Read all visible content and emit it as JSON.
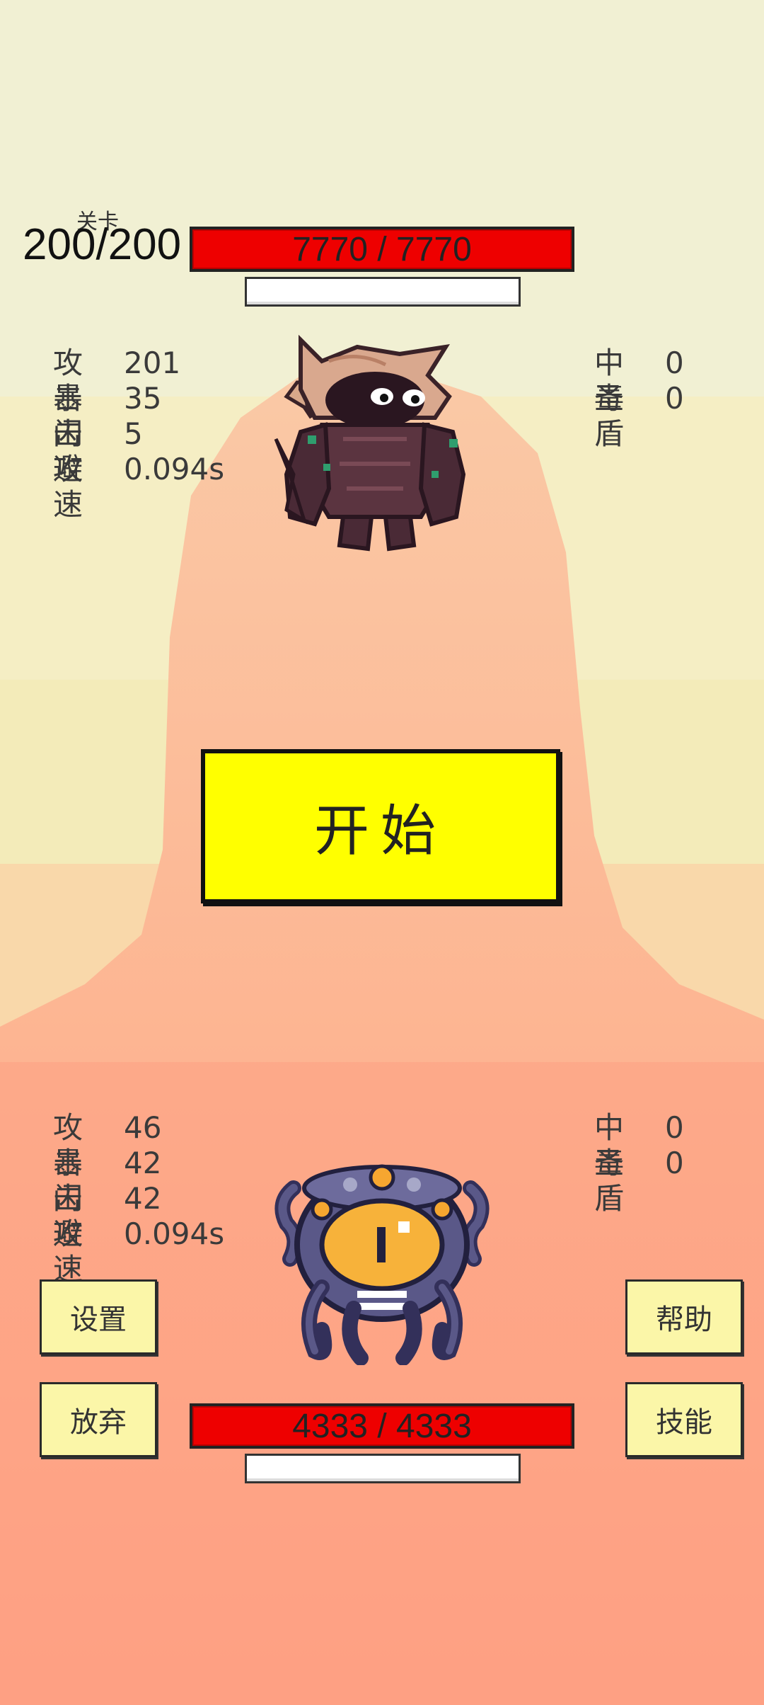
{
  "level": {
    "label": "关卡",
    "value": "200/200"
  },
  "enemy": {
    "hp_text": "7770 / 7770",
    "hp_fraction": 1.0,
    "stats_left": [
      {
        "label": "攻击",
        "value": "201"
      },
      {
        "label": "暴击",
        "value": "35"
      },
      {
        "label": "闪避",
        "value": "5"
      },
      {
        "label": "攻速",
        "value": "0.094s"
      }
    ],
    "stats_right": [
      {
        "label": "中毒",
        "value": "0"
      },
      {
        "label": "圣盾",
        "value": "0"
      }
    ],
    "sprite": "horned-golem-monster"
  },
  "player": {
    "hp_text": "4333 / 4333",
    "hp_fraction": 1.0,
    "stats_left": [
      {
        "label": "攻击",
        "value": "46"
      },
      {
        "label": "暴击",
        "value": "42"
      },
      {
        "label": "闪避",
        "value": "42"
      },
      {
        "label": "攻速",
        "value": "0.094s"
      }
    ],
    "stats_right": [
      {
        "label": "中毒",
        "value": "0"
      },
      {
        "label": "圣盾",
        "value": "0"
      }
    ],
    "sprite": "one-eyed-tentacle-monster"
  },
  "buttons": {
    "start": "开始",
    "settings": "设置",
    "help": "帮助",
    "give_up": "放弃",
    "skills": "技能"
  },
  "colors": {
    "hp_red": "#ee0000",
    "start_yellow": "#ffff00",
    "button_cream": "#fbf6a8",
    "sky": "#f1f0d3",
    "ground": "#fe9a7b"
  }
}
